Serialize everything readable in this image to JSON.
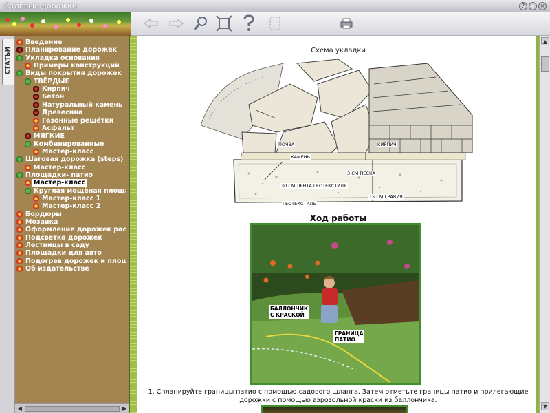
{
  "window": {
    "title": "Садовые дорожки"
  },
  "tabs": {
    "articles": "СТАТЬИ"
  },
  "tree": [
    {
      "label": "Введение",
      "icon": "flower-icon"
    },
    {
      "label": "Планирование дорожек",
      "icon": "dark-flower-icon"
    },
    {
      "label": "Укладка основания",
      "icon": "leaf-icon"
    },
    {
      "label": "Примеры конструкций",
      "icon": "flower-icon"
    },
    {
      "label": "Виды покрытия дорожек",
      "icon": "leaf-icon"
    },
    {
      "label": "ТВЁРДЫЕ",
      "icon": "leaf-icon"
    },
    {
      "label": "Кирпич",
      "icon": "dark-flower-icon"
    },
    {
      "label": "Бетон",
      "icon": "dark-flower-icon"
    },
    {
      "label": "Натуральный камень",
      "icon": "dark-flower-icon"
    },
    {
      "label": "Древесина",
      "icon": "dark-flower-icon"
    },
    {
      "label": "Газонные решётки",
      "icon": "flower-icon"
    },
    {
      "label": "Асфальт",
      "icon": "flower-icon"
    },
    {
      "label": "МЯГКИЕ",
      "icon": "dark-flower-icon"
    },
    {
      "label": "Комбинированные",
      "icon": "leaf-icon"
    },
    {
      "label": "Мастер-класс",
      "icon": "flower-icon"
    },
    {
      "label": "Шаговая дорожка (steps)",
      "icon": "leaf-icon"
    },
    {
      "label": "Мастер-класс",
      "icon": "flower-icon"
    },
    {
      "label": "Площадки- патио",
      "icon": "leaf-icon"
    },
    {
      "label": "Мастер-класс",
      "icon": "flower-icon"
    },
    {
      "label": "Круглая мощёная площадка",
      "icon": "leaf-icon"
    },
    {
      "label": "Мастер-класс 1",
      "icon": "flower-icon"
    },
    {
      "label": "Мастер-класс 2",
      "icon": "flower-icon"
    },
    {
      "label": "Бордюры",
      "icon": "flower-icon"
    },
    {
      "label": "Мозаика",
      "icon": "flower-icon"
    },
    {
      "label": "Оформление дорожек растения",
      "icon": "flower-icon"
    },
    {
      "label": "Подсветка дорожек",
      "icon": "flower-icon"
    },
    {
      "label": "Лестницы в саду",
      "icon": "flower-icon"
    },
    {
      "label": "Площадки для авто",
      "icon": "flower-icon"
    },
    {
      "label": "Подогрев дорожек и площадок",
      "icon": "flower-icon"
    },
    {
      "label": "Об издательстве",
      "icon": "flower-icon"
    }
  ],
  "content": {
    "scheme_title": "Схема укладки",
    "diagram_labels": {
      "soil": "ПОЧВА",
      "stone": "КАМЕНЬ",
      "brick": "КИРПИЧ",
      "sand": "3 СМ ПЕСКА",
      "tape": "30 СМ ЛЕНТА ГЕОТЕКСТИЛЯ",
      "geotextile": "ГЕОТЕКСТИЛЬ",
      "gravel": "15 СМ ГРАВИЯ"
    },
    "section_heading": "Ход работы",
    "photo_tags": {
      "spray": "БАЛЛОНЧИК\nС КРАСКОЙ",
      "border": "ГРАНИЦА\nПАТИО"
    },
    "caption": "1. Спланируйте границы патио с помощью садового шланга. Затем отметьте границы патио и прилегающие дорожки с помощью аэрозольной краски из баллончика."
  }
}
